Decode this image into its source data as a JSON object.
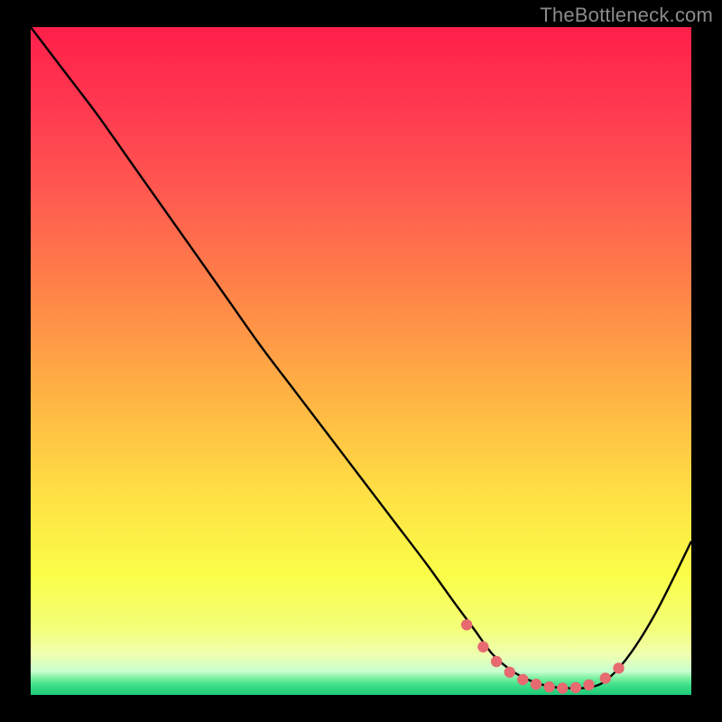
{
  "watermark": "TheBottleneck.com",
  "colors": {
    "accent_dots": "#e66a6f",
    "curve": "#000000",
    "border": "#000000"
  },
  "chart_data": {
    "type": "line",
    "title": "",
    "xlabel": "",
    "ylabel": "",
    "xlim": [
      0,
      1
    ],
    "ylim": [
      0,
      1
    ],
    "gradient_stops": [
      {
        "offset": 0.0,
        "color": "#ff1f4a"
      },
      {
        "offset": 0.12,
        "color": "#ff3950"
      },
      {
        "offset": 0.25,
        "color": "#ff5a50"
      },
      {
        "offset": 0.4,
        "color": "#ff8548"
      },
      {
        "offset": 0.55,
        "color": "#ffb244"
      },
      {
        "offset": 0.7,
        "color": "#ffe044"
      },
      {
        "offset": 0.82,
        "color": "#fafd48"
      },
      {
        "offset": 0.9,
        "color": "#f3ff78"
      },
      {
        "offset": 0.94,
        "color": "#eeffb0"
      },
      {
        "offset": 0.965,
        "color": "#c8ffd0"
      },
      {
        "offset": 0.975,
        "color": "#7af0a0"
      },
      {
        "offset": 0.985,
        "color": "#3fe08a"
      },
      {
        "offset": 1.0,
        "color": "#1cc877"
      }
    ],
    "series": [
      {
        "name": "curve",
        "x": [
          0.0,
          0.05,
          0.1,
          0.15,
          0.2,
          0.25,
          0.3,
          0.35,
          0.4,
          0.45,
          0.5,
          0.55,
          0.6,
          0.64,
          0.67,
          0.7,
          0.73,
          0.76,
          0.79,
          0.82,
          0.85,
          0.875,
          0.91,
          0.95,
          1.0
        ],
        "y": [
          1.0,
          0.935,
          0.87,
          0.8,
          0.73,
          0.66,
          0.59,
          0.52,
          0.455,
          0.39,
          0.325,
          0.26,
          0.195,
          0.14,
          0.1,
          0.06,
          0.035,
          0.02,
          0.012,
          0.01,
          0.012,
          0.025,
          0.065,
          0.13,
          0.23
        ]
      }
    ],
    "marker_points": {
      "name": "highlight",
      "x": [
        0.66,
        0.685,
        0.705,
        0.725,
        0.745,
        0.765,
        0.785,
        0.805,
        0.825,
        0.845,
        0.87,
        0.89
      ],
      "y": [
        0.105,
        0.072,
        0.05,
        0.034,
        0.023,
        0.016,
        0.012,
        0.01,
        0.011,
        0.015,
        0.025,
        0.04
      ]
    }
  }
}
